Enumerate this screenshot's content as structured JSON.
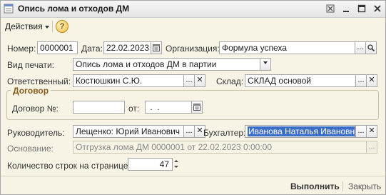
{
  "window": {
    "title": "Опись лома и отходов ДМ"
  },
  "toolbar": {
    "actions_label": "Действия",
    "help_label": "?"
  },
  "form": {
    "number_label": "Номер:",
    "number_value": "0000001",
    "date_label": "Дата:",
    "date_value": "22.02.2023",
    "org_label": "Организация:",
    "org_value": "Формула успеха",
    "print_label": "Вид печати:",
    "print_value": "Опись лома и отходов ДМ в партии",
    "responsible_label": "Ответственный:",
    "responsible_value": "Костюшкин С.Ю.",
    "warehouse_label": "Склад:",
    "warehouse_value": "СКЛАД основой",
    "contract_group_title": "Договор",
    "contract_label": "Договор №:",
    "contract_value": "",
    "contract_date_label": "от:",
    "contract_date_value": " .  .",
    "head_label": "Руководитель:",
    "head_value": "Лещенко: Юрий Иванович",
    "accountant_label": "Бухгалтер:",
    "accountant_value": "Иванова Наталья Ивановна",
    "basis_label": "Основание:",
    "basis_value": "Отгрузка лома ДМ 0000001 от 22.02.2023 0:00:00",
    "rows_label": "Количество строк на странице:",
    "rows_value": "47",
    "ellipsis": "...",
    "clear_glyph": "✕"
  },
  "footer": {
    "execute_label": "Выполнить",
    "close_label": "Закрыть"
  },
  "icons": [
    "app-form-icon",
    "close-window-icon",
    "restore-icon",
    "maximize-icon",
    "close-icon",
    "calendar-icon",
    "search-icon",
    "dropdown-arrow-icon",
    "clear-icon",
    "spinner-icon"
  ]
}
